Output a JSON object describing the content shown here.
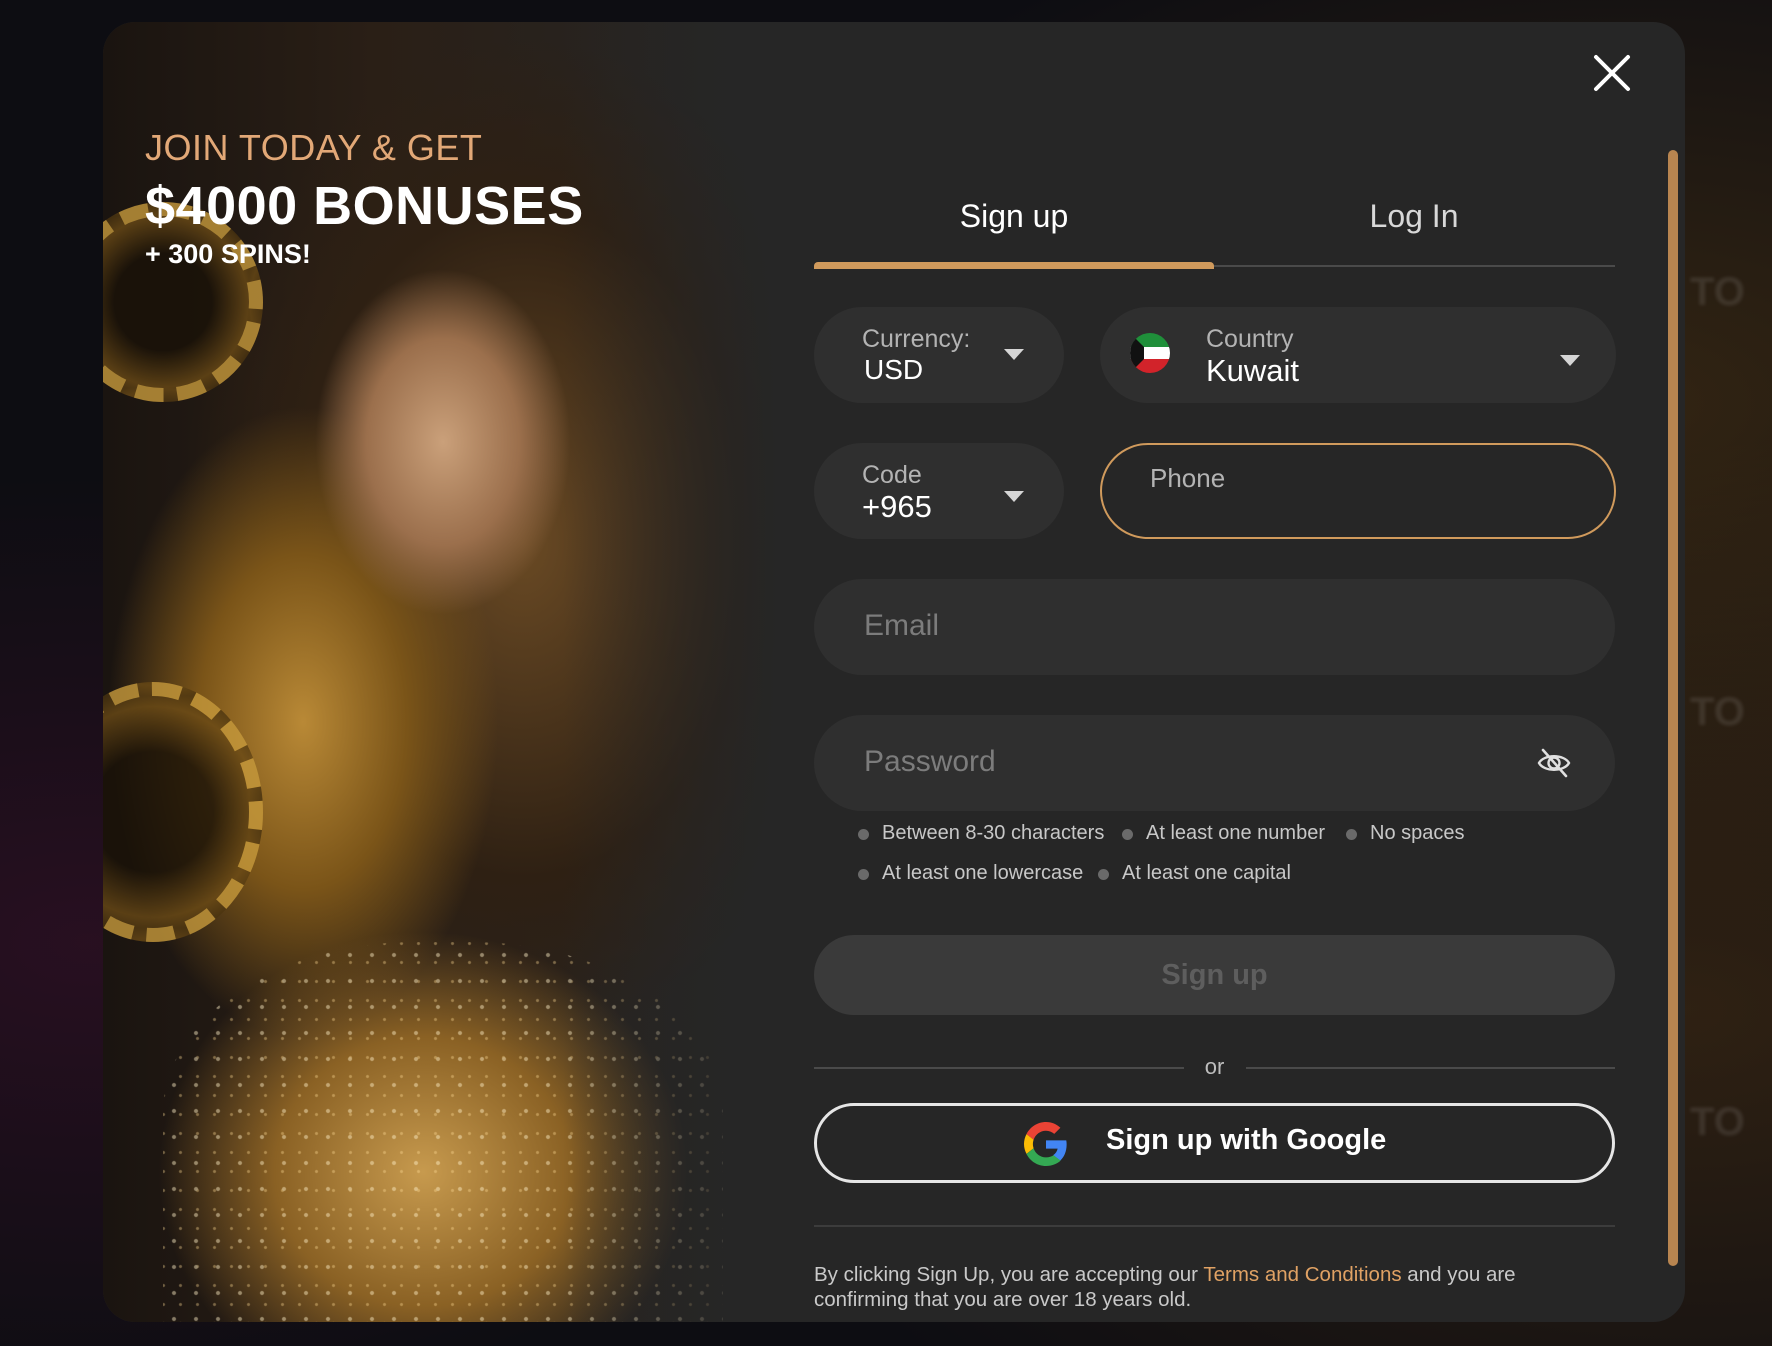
{
  "promo": {
    "line1": "JOIN TODAY & GET",
    "line2": "$4000 BONUSES",
    "line3": "+ 300 SPINS!"
  },
  "tabs": [
    {
      "label": "Sign up",
      "active": true
    },
    {
      "label": "Log In",
      "active": false
    }
  ],
  "currency": {
    "label": "Currency:",
    "value": "USD"
  },
  "country": {
    "label": "Country",
    "value": "Kuwait",
    "flag_icon": "kuwait-flag-icon"
  },
  "code": {
    "label": "Code",
    "value": "+965"
  },
  "phone": {
    "placeholder": "Phone",
    "value": ""
  },
  "email": {
    "placeholder": "Email",
    "value": ""
  },
  "password": {
    "placeholder": "Password",
    "value": "",
    "toggle_icon": "eye-off-icon"
  },
  "password_rules": [
    "Between 8-30 characters",
    "At least one number",
    "No spaces",
    "At least one lowercase",
    "At least one capital"
  ],
  "signup_button": "Sign up",
  "or_label": "or",
  "google_button": {
    "label": "Sign up with Google",
    "icon": "google-icon"
  },
  "terms": {
    "prefix": "By clicking Sign Up, you are accepting our ",
    "link": "Terms and Conditions",
    "suffix": " and you are confirming that you are over 18 years old."
  },
  "colors": {
    "accent": "#d09a5c",
    "link": "#e0a264",
    "modal_bg": "#262626",
    "field_bg": "#2f2f2f"
  }
}
